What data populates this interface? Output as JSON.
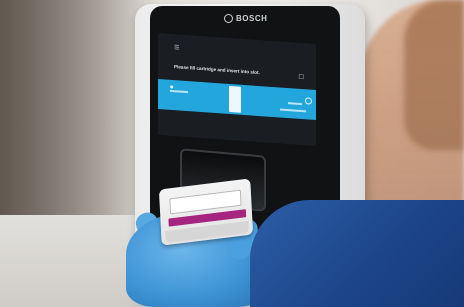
{
  "device": {
    "brand": "BOSCH"
  },
  "screen": {
    "message": "Please fill cartridge and insert into slot.",
    "band_color": "#22a6dc"
  },
  "colors": {
    "glove": "#3c93d4",
    "sleeve": "#1c4488",
    "cartridge_stripe": "#a5257f"
  },
  "icons": {
    "screen_top": "menu-icon",
    "screen_right": "document-icon",
    "brand_mark": "bosch-logo-icon"
  }
}
